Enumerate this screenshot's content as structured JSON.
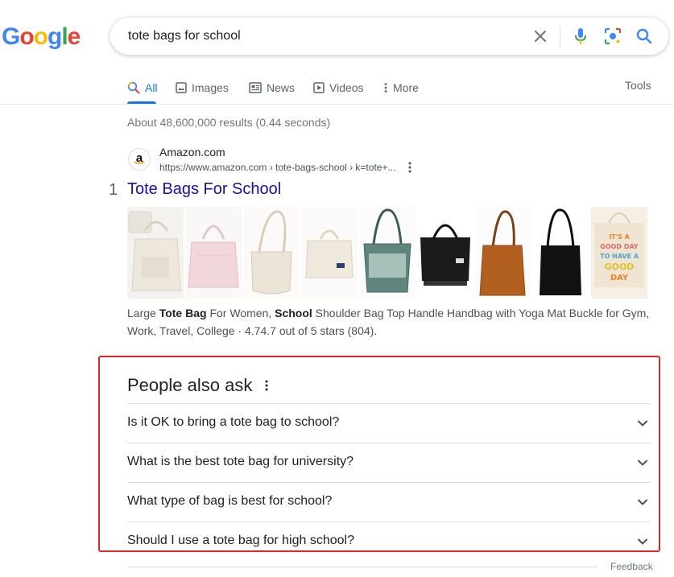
{
  "logo": {
    "text": "Google",
    "letters": [
      "G",
      "o",
      "o",
      "g",
      "l",
      "e"
    ],
    "colors": [
      "#4285F4",
      "#EA4335",
      "#FBBC05",
      "#4285F4",
      "#34A853",
      "#EA4335"
    ]
  },
  "search": {
    "query": "tote bags for school"
  },
  "tabs": [
    {
      "label": "All",
      "active": true
    },
    {
      "label": "Images"
    },
    {
      "label": "News"
    },
    {
      "label": "Videos"
    },
    {
      "label": "More"
    }
  ],
  "tools_label": "Tools",
  "stats": "About 48,600,000 results (0.44 seconds)",
  "result": {
    "favicon_letter": "a",
    "site_name": "Amazon.com",
    "url": "https://www.amazon.com › tote-bags-school › k=tote+...",
    "number": "1",
    "title": "Tote Bags For School",
    "snippet_parts": [
      {
        "text": "Large ",
        "bold": false
      },
      {
        "text": "Tote Bag",
        "bold": true
      },
      {
        "text": " For Women, ",
        "bold": false
      },
      {
        "text": "School",
        "bold": true
      },
      {
        "text": " Shoulder Bag Top Handle Handbag with Yoga Mat Buckle for Gym, Work, Travel, College · 4.74.7 out of 5 stars (804).",
        "bold": false
      }
    ],
    "thumbnail_text": [
      "IT'S A",
      "GOOD DAY",
      "TO HAVE A",
      "GOOD",
      "DAY"
    ]
  },
  "people_also_ask": {
    "title": "People also ask",
    "questions": [
      "Is it OK to bring a tote bag to school?",
      "What is the best tote bag for university?",
      "What type of bag is best for school?",
      "Should I use a tote bag for high school?"
    ]
  },
  "feedback_label": "Feedback",
  "colors": {
    "link": "#1a0dab",
    "accent": "#1a73e8",
    "highlight_box": "#e4262c"
  }
}
